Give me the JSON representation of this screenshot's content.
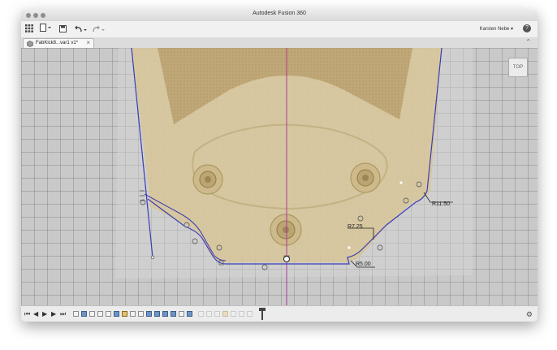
{
  "window": {
    "title": "Autodesk Fusion 360"
  },
  "toolbar": {
    "items": [
      {
        "icon": "grid-icon"
      },
      {
        "icon": "file-icon"
      },
      {
        "icon": "save-icon"
      },
      {
        "icon": "undo-icon"
      },
      {
        "icon": "redo-icon"
      }
    ],
    "user_name": "Karsten Nebe",
    "help_label": "?"
  },
  "tab": {
    "label": "FabKick8...var1 v1*",
    "close_label": "×"
  },
  "viewcube": {
    "label": "TOP"
  },
  "sketch": {
    "dimensions": [
      {
        "label": "R11.50"
      },
      {
        "label": "R7.25"
      },
      {
        "label": "R5.00"
      }
    ],
    "colors": {
      "board": "#d6c59a",
      "sketch_line": "#3b3bb5",
      "axis_line": "#b0389a"
    }
  },
  "timeline": {
    "controls": [
      {
        "icon": "skip-to-start-icon",
        "glyph": "⏮"
      },
      {
        "icon": "step-back-icon",
        "glyph": "◀"
      },
      {
        "icon": "play-icon",
        "glyph": "▶"
      },
      {
        "icon": "step-forward-icon",
        "glyph": "▶"
      },
      {
        "icon": "skip-to-end-icon",
        "glyph": "⏭"
      }
    ]
  }
}
